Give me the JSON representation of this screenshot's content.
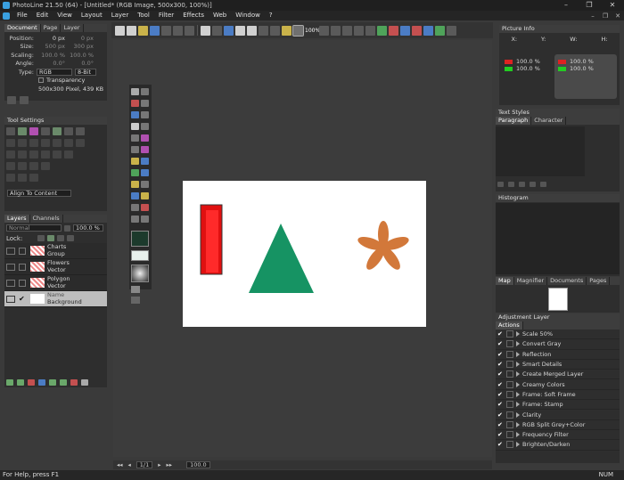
{
  "window": {
    "title": "PhotoLine 21.50 (64) - [Untitled* (RGB Image, 500x300, 100%)]"
  },
  "menu": [
    "File",
    "Edit",
    "View",
    "Layout",
    "Layer",
    "Tool",
    "Filter",
    "Effects",
    "Web",
    "Window",
    "?"
  ],
  "toolbar": {
    "zoom_label": "100%"
  },
  "doc_panel": {
    "tabs": [
      "Document",
      "Page",
      "Layer"
    ],
    "rows": [
      {
        "label": "Position:",
        "v1": "0 px",
        "v2": "0 px"
      },
      {
        "label": "Size:",
        "v1": "500 px",
        "v2": "300 px"
      },
      {
        "label": "Scaling:",
        "v1": "100.0 %",
        "v2": "100.0 %"
      },
      {
        "label": "Angle:",
        "v1": "0.0°",
        "v2": "0.0°"
      }
    ],
    "type_label": "Type:",
    "type_value": "RGB",
    "bit_value": "8-Bit",
    "transparency_label": "Transparency",
    "size_info": "500x300 Pixel, 439 KB"
  },
  "tool_settings": {
    "title": "Tool Settings",
    "align_value": "Align To Content"
  },
  "layers": {
    "tabs": [
      "Layers",
      "Channels"
    ],
    "mode": "Normal",
    "opacity": "100.0 %",
    "lock_label": "Lock:",
    "items": [
      {
        "name": "Charts",
        "type": "Group"
      },
      {
        "name": "Flowers",
        "type": "Vector"
      },
      {
        "name": "Polygon",
        "type": "Vector"
      },
      {
        "name": "Name",
        "type": "Background"
      }
    ]
  },
  "picture_info": {
    "title": "Picture Info",
    "headers": [
      "X:",
      "Y:",
      "W:",
      "H:"
    ],
    "left_rows": [
      "100.0 %",
      "100.0 %"
    ],
    "right_rows": [
      "100.0 %",
      "100.0 %"
    ]
  },
  "text_styles": {
    "title": "Text Styles",
    "tabs": [
      "Paragraph",
      "Character"
    ]
  },
  "histogram": {
    "title": "Histogram"
  },
  "map": {
    "tabs": [
      "Map",
      "Magnifier",
      "Documents",
      "Pages"
    ]
  },
  "adjustment": {
    "title": "Adjustment Layer",
    "actions_tab": "Actions",
    "actions": [
      "Scale 50%",
      "Convert Gray",
      "Reflection",
      "Smart Details",
      "Create Merged Layer",
      "Creamy Colors",
      "Frame: Soft Frame",
      "Frame: Stamp",
      "Clarity",
      "RGB Split Grey+Color",
      "Frequency Filter",
      "Brighten/Darken"
    ]
  },
  "page_nav": {
    "page": "1/1",
    "zoom": "100.0"
  },
  "status": {
    "help": "For Help, press F1",
    "num": "NUM"
  },
  "colors": {
    "accent": "#3aa0e0",
    "triangle": "#169363",
    "bar": "#e01010",
    "flower": "#d2783a"
  }
}
